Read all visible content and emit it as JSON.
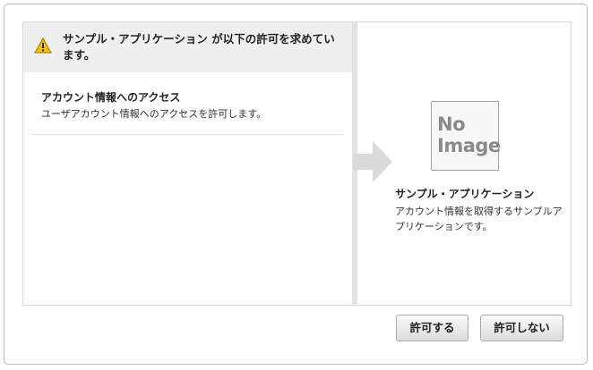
{
  "dialog": {
    "header_message": "サンプル・アプリケーション が以下の許可を求めています。",
    "icon": "warning-icon"
  },
  "permission": {
    "title": "アカウント情報へのアクセス",
    "description": "ユーザアカウント情報へのアクセスを許可します。"
  },
  "application": {
    "image_placeholder_line1": "No",
    "image_placeholder_line2": "Image",
    "name": "サンプル・アプリケーション",
    "description": "アカウント情報を取得するサンプルアプリケーションです。"
  },
  "buttons": {
    "allow_label": "許可する",
    "deny_label": "許可しない"
  },
  "colors": {
    "header_bg": "#efefef",
    "warning_yellow": "#f2c200",
    "arrow_gray": "#dadada"
  }
}
